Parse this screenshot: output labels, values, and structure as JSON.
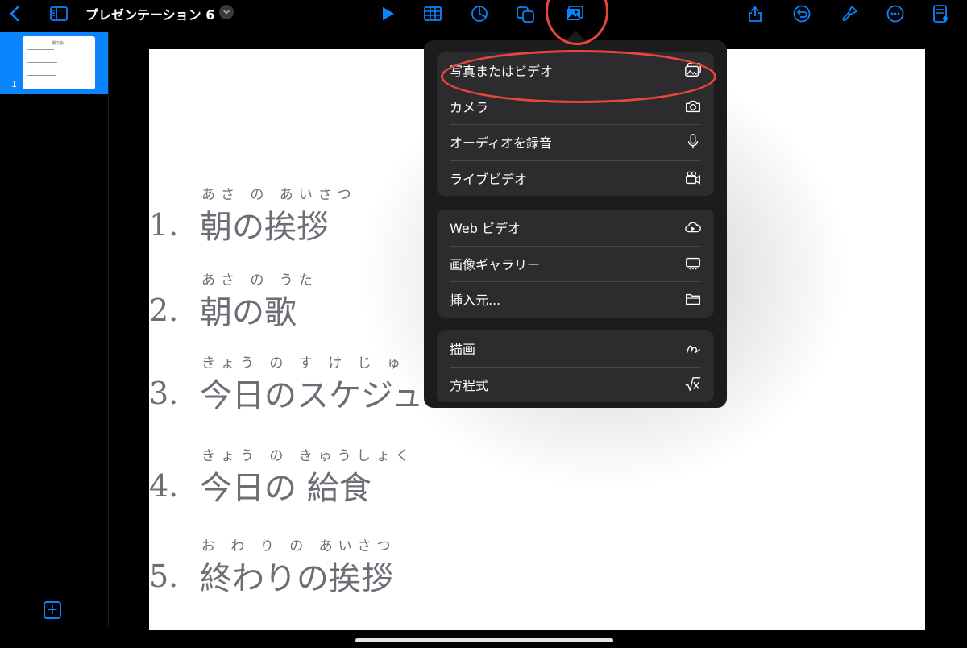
{
  "toolbar": {
    "title": "プレゼンテーション 6",
    "accent": "#0a84ff",
    "icons": [
      "back-icon",
      "sidebar-icon",
      "chevron-down-icon",
      "play-icon",
      "table-icon",
      "chart-icon",
      "shape-icon",
      "media-icon",
      "share-icon",
      "undo-icon",
      "format-brush-icon",
      "more-icon",
      "presenter-notes-icon"
    ]
  },
  "sidebar": {
    "thumb_number": "1",
    "thumb_title": "朝の会",
    "add_label": "+"
  },
  "slide": {
    "items": [
      {
        "num": "1.",
        "ruby": "あさ の あいさつ",
        "text": "朝の挨拶"
      },
      {
        "num": "2.",
        "ruby": "あさ の うた",
        "text": "朝の歌"
      },
      {
        "num": "3.",
        "ruby": "きょう の す け じ ゅ",
        "text": "今日のスケジュ"
      },
      {
        "num": "4.",
        "ruby": "きょう の きゅうしょく",
        "text": "今日の 給食"
      },
      {
        "num": "5.",
        "ruby": "お わ り の あいさつ",
        "text": "終わりの挨拶"
      }
    ]
  },
  "menu": {
    "groups": [
      [
        {
          "label": "写真またはビデオ",
          "icon": "photo-library-icon"
        },
        {
          "label": "カメラ",
          "icon": "camera-icon"
        },
        {
          "label": "オーディオを録音",
          "icon": "microphone-icon"
        },
        {
          "label": "ライブビデオ",
          "icon": "video-camera-icon"
        }
      ],
      [
        {
          "label": "Web ビデオ",
          "icon": "cloud-play-icon"
        },
        {
          "label": "画像ギャラリー",
          "icon": "gallery-icon"
        },
        {
          "label": "挿入元...",
          "icon": "folder-icon"
        }
      ],
      [
        {
          "label": "描画",
          "icon": "draw-icon"
        },
        {
          "label": "方程式",
          "icon": "equation-icon"
        }
      ]
    ]
  },
  "annotation_color": "#e8453c"
}
